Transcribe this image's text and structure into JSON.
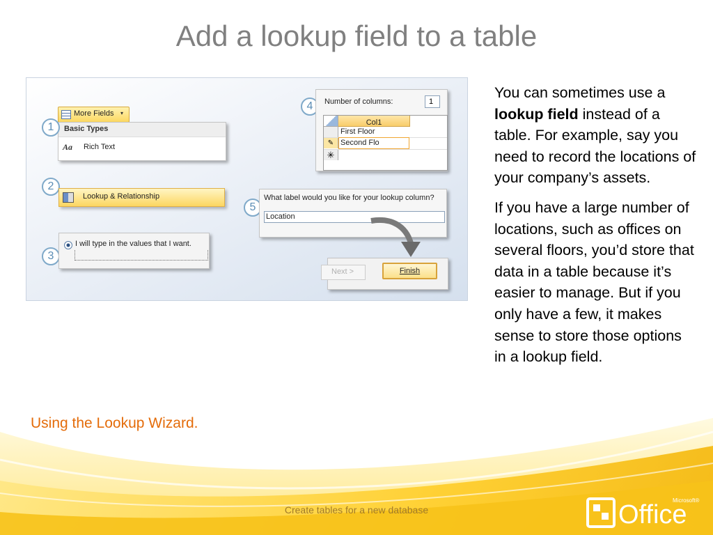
{
  "slide": {
    "title": "Add a lookup field to a table",
    "caption": "Using the Lookup Wizard.",
    "body": {
      "p1_part1": "You can sometimes use a ",
      "p1_bold": "lookup field",
      "p1_part2": " instead of a table. For example, say you need to record the locations of your company’s assets.",
      "p2": "If you have a large number of locations, such as offices on several floors, you’d store that data in a table because it’s easier to manage. But if you only have a few, it makes sense to store those options in a lookup field."
    },
    "footer": "Create tables for a new database"
  },
  "screenshot": {
    "steps": [
      "1",
      "2",
      "3",
      "4",
      "5"
    ],
    "more_fields_label": "More Fields",
    "basic_types_header": "Basic Types",
    "rich_text_label": "Rich Text",
    "lookup_rel_label": "Lookup & Relationship",
    "radio_label": "I will type in the values that I want.",
    "num_columns_label": "Number of columns:",
    "num_columns_value": "1",
    "grid_header": "Col1",
    "grid_rows": [
      "First Floor",
      "Second Flo"
    ],
    "label_prompt": "What label would you like for your lookup column?",
    "label_value": "Location",
    "next_label": "Next >",
    "finish_label": "Finish"
  },
  "logo": {
    "text": "Office",
    "brand": "Microsoft®"
  }
}
